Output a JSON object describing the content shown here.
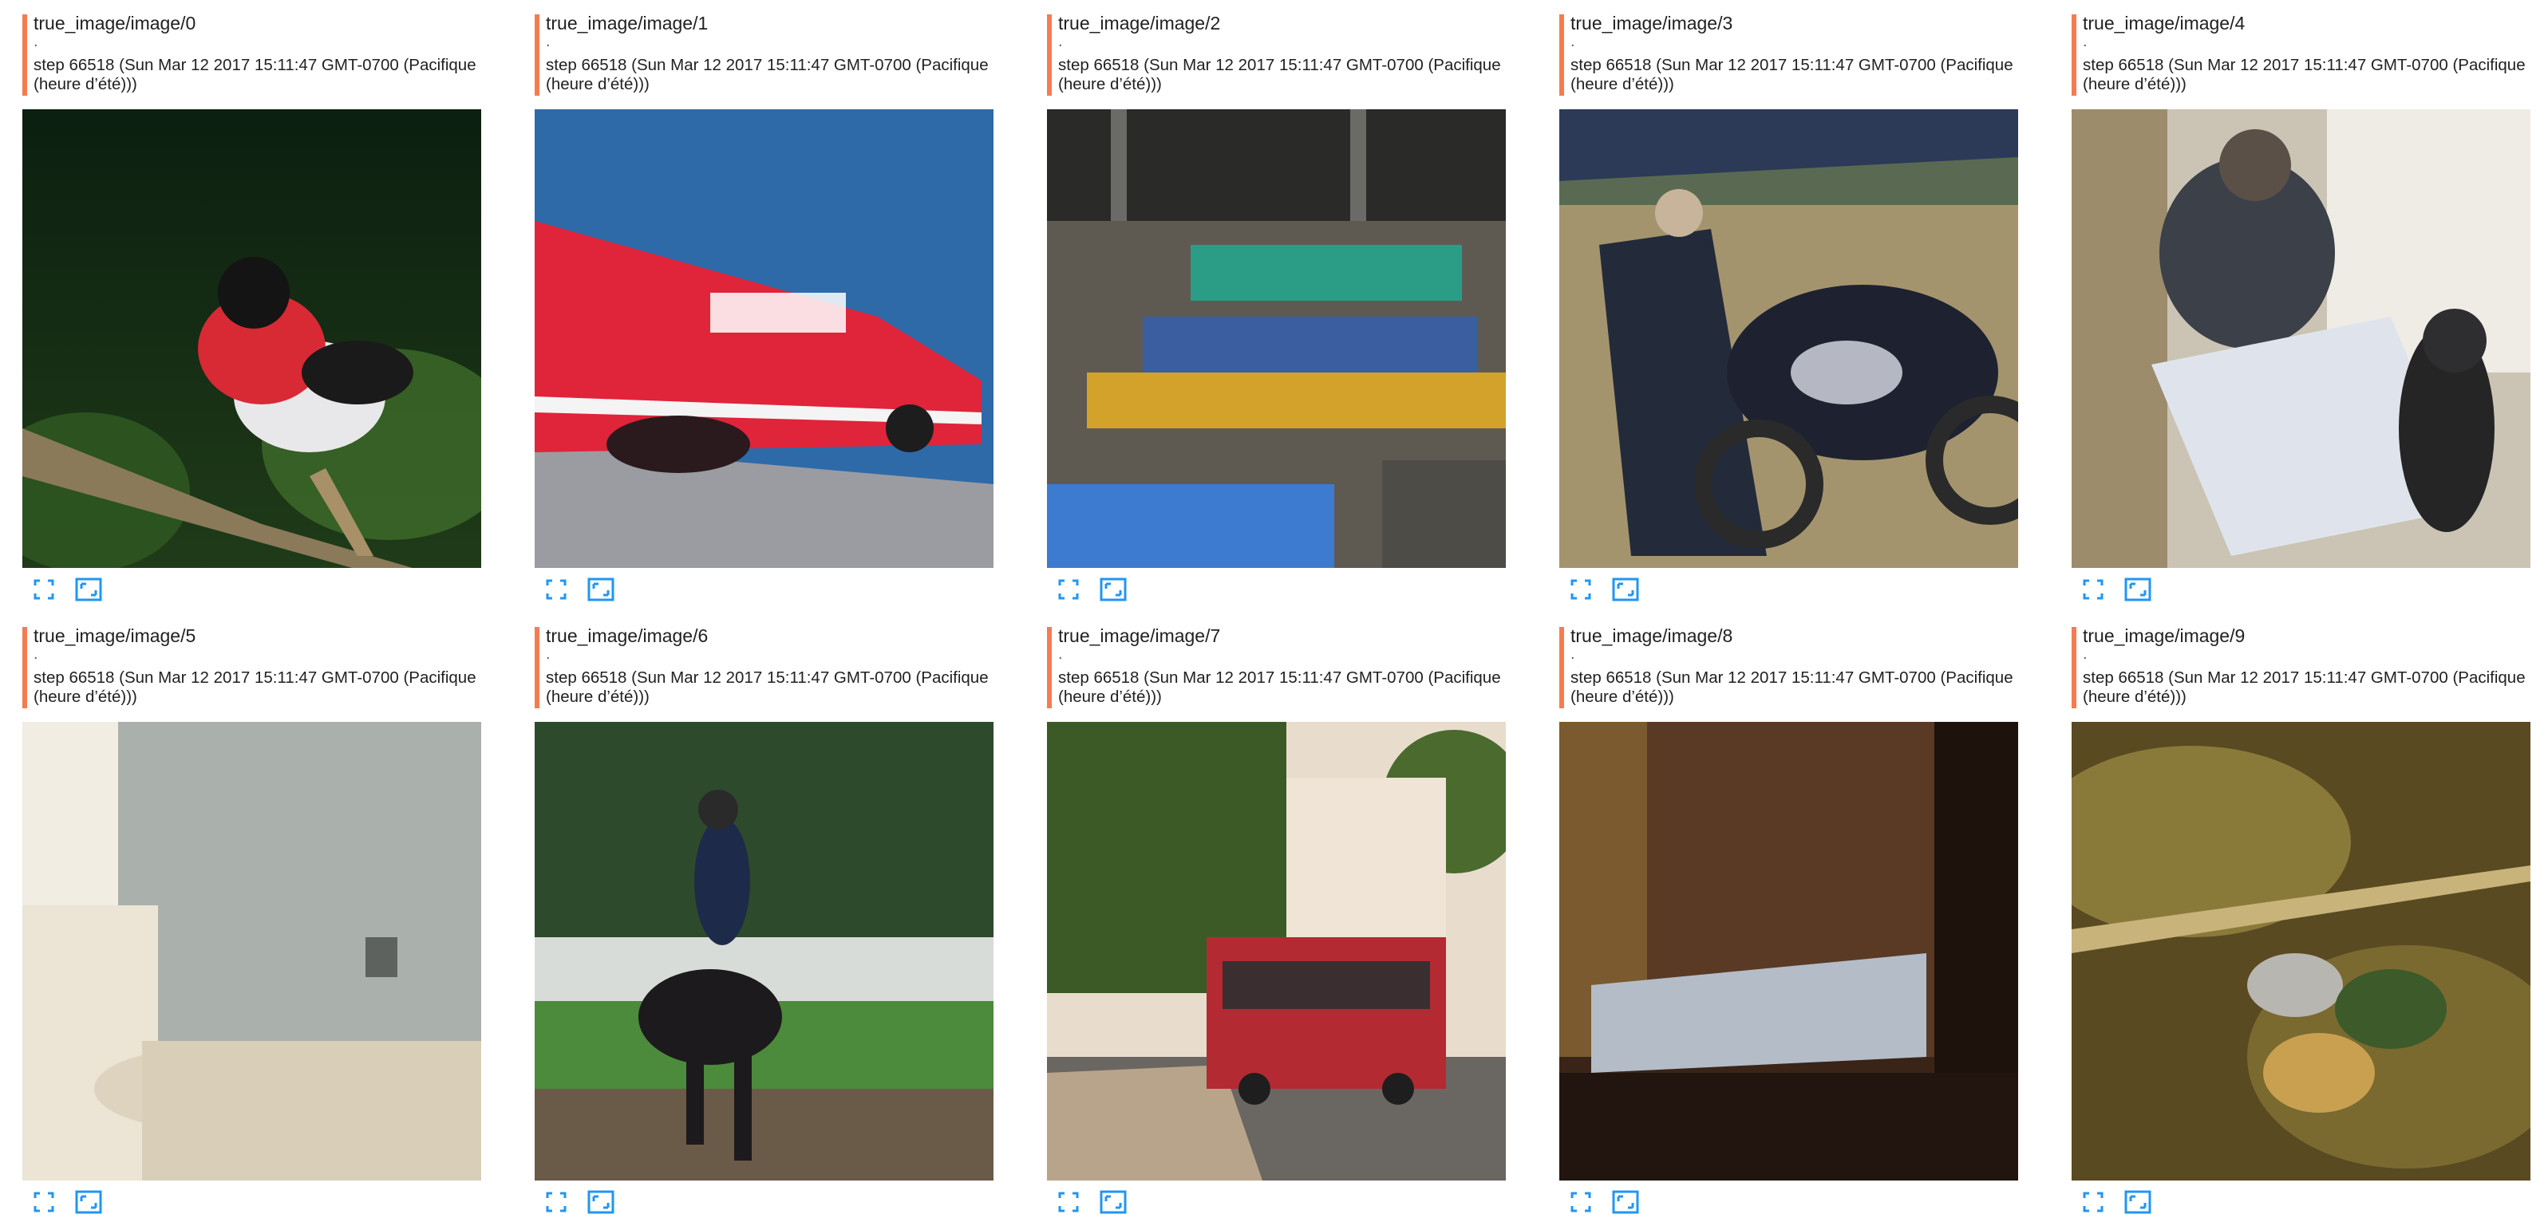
{
  "accent_color": "#f57c4f",
  "icon_color": "#2196f3",
  "cards": [
    {
      "tag": "true_image/image/0",
      "dot": ".",
      "step": "step 66518 (Sun Mar 12 2017 15:11:47 GMT-0700 (Pacifique (heure d’été)))",
      "icons": [
        "fullscreen-icon",
        "actual-size-icon"
      ]
    },
    {
      "tag": "true_image/image/1",
      "dot": ".",
      "step": "step 66518 (Sun Mar 12 2017 15:11:47 GMT-0700 (Pacifique (heure d’été)))",
      "icons": [
        "fullscreen-icon",
        "actual-size-icon"
      ]
    },
    {
      "tag": "true_image/image/2",
      "dot": ".",
      "step": "step 66518 (Sun Mar 12 2017 15:11:47 GMT-0700 (Pacifique (heure d’été)))",
      "icons": [
        "fullscreen-icon",
        "actual-size-icon"
      ]
    },
    {
      "tag": "true_image/image/3",
      "dot": ".",
      "step": "step 66518 (Sun Mar 12 2017 15:11:47 GMT-0700 (Pacifique (heure d’été)))",
      "icons": [
        "fullscreen-icon",
        "actual-size-icon"
      ]
    },
    {
      "tag": "true_image/image/4",
      "dot": ".",
      "step": "step 66518 (Sun Mar 12 2017 15:11:47 GMT-0700 (Pacifique (heure d’été)))",
      "icons": [
        "fullscreen-icon",
        "actual-size-icon"
      ]
    },
    {
      "tag": "true_image/image/5",
      "dot": ".",
      "step": "step 66518 (Sun Mar 12 2017 15:11:47 GMT-0700 (Pacifique (heure d’été)))",
      "icons": [
        "fullscreen-icon",
        "actual-size-icon"
      ]
    },
    {
      "tag": "true_image/image/6",
      "dot": ".",
      "step": "step 66518 (Sun Mar 12 2017 15:11:47 GMT-0700 (Pacifique (heure d’été)))",
      "icons": [
        "fullscreen-icon",
        "actual-size-icon"
      ]
    },
    {
      "tag": "true_image/image/7",
      "dot": ".",
      "step": "step 66518 (Sun Mar 12 2017 15:11:47 GMT-0700 (Pacifique (heure d’été)))",
      "icons": [
        "fullscreen-icon",
        "actual-size-icon"
      ]
    },
    {
      "tag": "true_image/image/8",
      "dot": ".",
      "step": "step 66518 (Sun Mar 12 2017 15:11:47 GMT-0700 (Pacifique (heure d’été)))",
      "icons": [
        "fullscreen-icon",
        "actual-size-icon"
      ]
    },
    {
      "tag": "true_image/image/9",
      "dot": ".",
      "step": "step 66518 (Sun Mar 12 2017 15:11:47 GMT-0700 (Pacifique (heure d’été)))",
      "icons": [
        "fullscreen-icon",
        "actual-size-icon"
      ]
    }
  ]
}
